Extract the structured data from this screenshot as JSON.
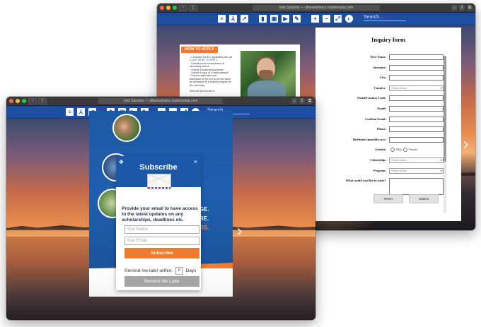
{
  "back_window": {
    "url": "Visit Sunsets — uflanewtowns.marketsolar.com",
    "toolbar_search": "Search...",
    "apply": {
      "tag": "HOW TO APPLY",
      "lines": [
        "- Complete the ELI application and ad",
        "  CLICK HERE TO APPLY",
        "- Submit proof of completion of",
        "  secondary school",
        "- Submit a financial guarantee",
        "- Submit a copy of a valid passport",
        "- Pay the application fee",
        "Admission to the ELI is not the same",
        "as admission to a degree program at",
        "the university.",
        "",
        "Send all documents to"
      ]
    },
    "form": {
      "title": "Inquiry form",
      "fields": [
        {
          "label": "First Name:",
          "type": "text"
        },
        {
          "label": "Surname:",
          "type": "text"
        },
        {
          "label": "City:",
          "type": "text"
        },
        {
          "label": "Country:",
          "type": "select",
          "value": "Please Select..."
        },
        {
          "label": "Postal/Country Code:",
          "type": "text"
        },
        {
          "label": "Email:",
          "type": "text"
        },
        {
          "label": "Confirm Email:",
          "type": "text"
        },
        {
          "label": "Phone:",
          "type": "text"
        },
        {
          "label": "Birthdate (mm/dd/yyyy):",
          "type": "text"
        },
        {
          "label": "Gender:",
          "type": "radio",
          "options": [
            "Male",
            "Female"
          ]
        },
        {
          "label": "Citizenship:",
          "type": "select",
          "value": "Please Select..."
        },
        {
          "label": "Program:",
          "type": "select",
          "value": "Please Select..."
        },
        {
          "label": "What would you like to study?",
          "type": "textarea"
        }
      ],
      "reset_label": "Reset",
      "submit_label": "Submit"
    }
  },
  "front_window": {
    "url": "Visit Sunsets — uflanewtowns.marketsolar.com",
    "toolbar_search": "Search...",
    "flyer_texts": [
      "AGE.",
      "URE.",
      "ORS."
    ],
    "modal": {
      "title": "Subscribe",
      "description": "Provide your email to have access to the latest updates on any scholarships, deadlines etc.",
      "name_placeholder": "Your Name",
      "email_placeholder": "Your Email",
      "subscribe_label": "Subscribe",
      "remind_prefix": "Remind me later within:",
      "remind_value": "0",
      "remind_suffix": "Days",
      "remind_button": "Remind Me Later"
    }
  },
  "colors": {
    "toolbar_blue": "#1d4fa0",
    "accent_orange": "#f07a2e",
    "modal_header": "#1d57a7"
  },
  "toolbar_icons": [
    "toc-icon",
    "pdf-icon",
    "share-icon",
    "bookmark-icon",
    "image-icon",
    "video-icon",
    "edit-icon",
    "zoom-in-icon",
    "zoom-out-icon",
    "fit-icon",
    "fullscreen-icon"
  ]
}
